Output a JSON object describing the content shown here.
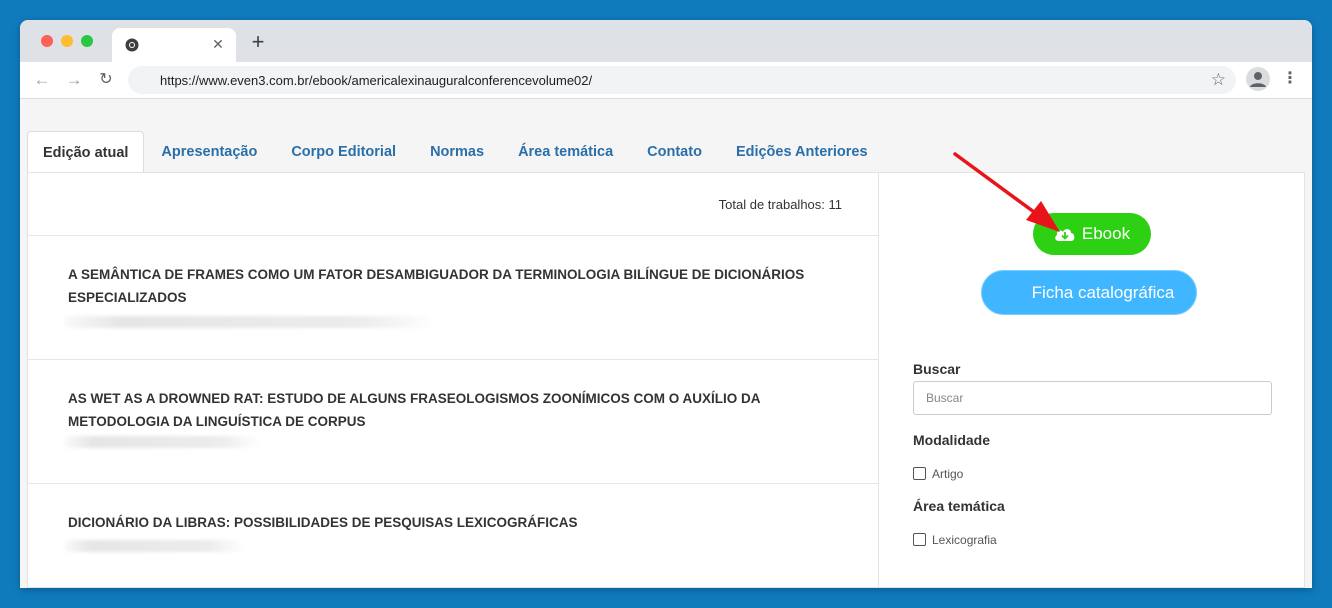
{
  "browser": {
    "tab_close": "✕",
    "new_tab": "+",
    "url": "https://www.even3.com.br/ebook/americalexinauguralconferencevolume02/"
  },
  "site_tabs": [
    {
      "label": "Edição atual",
      "active": true
    },
    {
      "label": "Apresentação",
      "active": false
    },
    {
      "label": "Corpo Editorial",
      "active": false
    },
    {
      "label": "Normas",
      "active": false
    },
    {
      "label": "Área temática",
      "active": false
    },
    {
      "label": "Contato",
      "active": false
    },
    {
      "label": "Edições Anteriores",
      "active": false
    }
  ],
  "main": {
    "total": "Total de trabalhos: 11",
    "items": [
      {
        "title": "A SEMÂNTICA DE FRAMES COMO UM FATOR DESAMBIGUADOR DA TERMINOLOGIA BILÍNGUE DE DICIONÁRIOS ESPECIALIZADOS"
      },
      {
        "title": "AS WET AS A DROWNED RAT: ESTUDO DE ALGUNS FRASEOLOGISMOS ZOONÍMICOS COM O AUXÍLIO DA METODOLOGIA DA LINGUÍSTICA DE CORPUS"
      },
      {
        "title": "DICIONÁRIO DA LIBRAS: POSSIBILIDADES DE PESQUISAS LEXICOGRÁFICAS"
      }
    ]
  },
  "sidebar": {
    "ebook_label": "Ebook",
    "ficha_label": "Ficha catalográfica",
    "search_label": "Buscar",
    "search_placeholder": "Buscar",
    "modalidade_label": "Modalidade",
    "modalidade_option": "Artigo",
    "area_label": "Área temática",
    "area_option": "Lexicografia"
  },
  "colors": {
    "ebook_button": "#2ed013",
    "ficha_button": "#3fb6ff",
    "tab_link": "#2a6fa8",
    "annotation_arrow": "#e8141a"
  }
}
